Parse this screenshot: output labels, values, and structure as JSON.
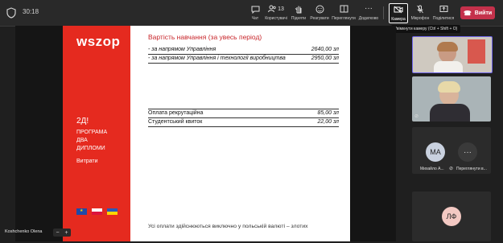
{
  "meeting": {
    "timer": "30:18"
  },
  "toolbar": {
    "chat_label": "Чат",
    "people_label": "Користувачі",
    "people_count": "13",
    "raise_label": "Підняти",
    "react_label": "Реагувати",
    "view_label": "Переглянути",
    "more_label": "Додатково",
    "camera_label": "Камера",
    "mic_label": "Мікрофон",
    "share_label": "Поділитися",
    "leave_label": "Вийти",
    "camera_tooltip": "Увімкнути камеру (Ctrl + Shift + O)",
    "colors": {
      "leave": "#c4314b",
      "active_tile_border": "#6f66e8"
    }
  },
  "slide": {
    "logo": "wszop",
    "headline": "2Д!",
    "program_lines": [
      "ПРОГРАМА",
      "ДВА",
      "ДИПЛОМИ"
    ],
    "section": "Витрати",
    "title": "Вартість навчання (за увесь період)",
    "rows_top": [
      {
        "label": "- за напрямом Управління",
        "value": "2640,00 зл"
      },
      {
        "label": "- за напрямом Управління і технології виробництва",
        "value": "2950,00 зл"
      }
    ],
    "rows_bottom": [
      {
        "label": "Оплата рекрутаційна",
        "value": "85,00 зл"
      },
      {
        "label": "Студентський квиток",
        "value": "22,00 зл"
      }
    ],
    "footer": "Усі оплати здійснюються виключно у польській валюті – злотих",
    "colors": {
      "red_panel": "#e52a1f",
      "title": "#c8262b"
    }
  },
  "presenter": {
    "name": "Koshchenko Olena"
  },
  "participants": [
    {
      "initials": "МА",
      "name": "Михайло А...",
      "avatar_color": "#c9d1df"
    },
    {
      "initials": "",
      "name": "Переглянути в..."
    },
    {
      "initials": "ЛФ",
      "name": "",
      "avatar_color": "#f3c9c3"
    }
  ],
  "icons": [
    "shield-icon",
    "chat-icon",
    "people-icon",
    "hand-icon",
    "smile-icon",
    "view-icon",
    "more-icon",
    "camera-icon",
    "mic-icon",
    "share-icon",
    "phone-icon"
  ]
}
